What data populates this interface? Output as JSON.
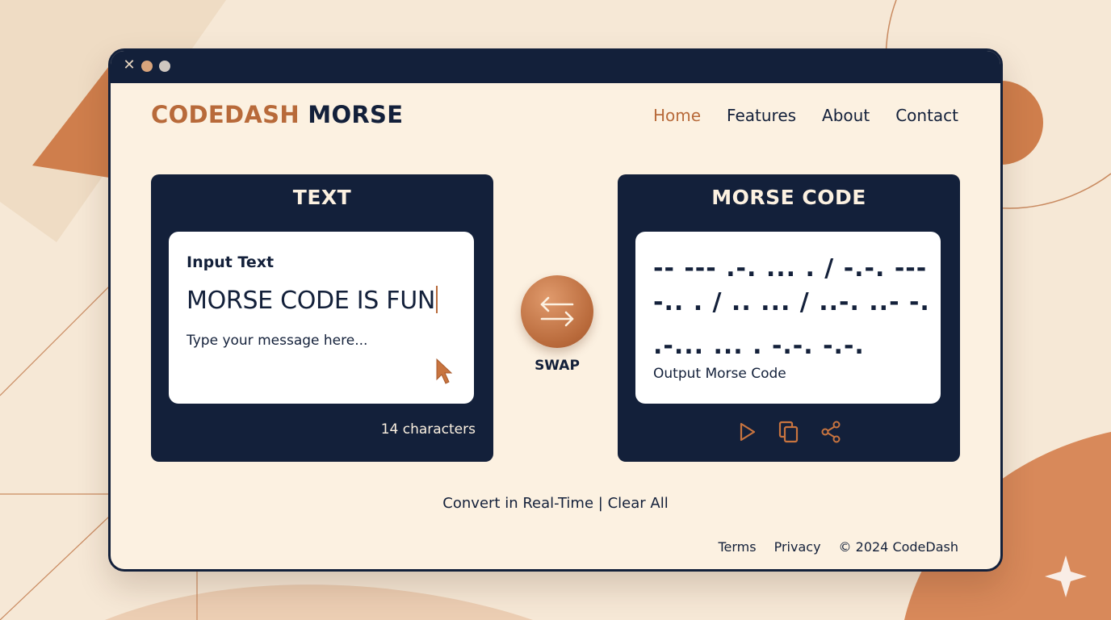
{
  "brand": {
    "part1": "CODEDASH",
    "part2": "MORSE"
  },
  "nav": [
    {
      "label": "Home",
      "active": true
    },
    {
      "label": "Features",
      "active": false
    },
    {
      "label": "About",
      "active": false
    },
    {
      "label": "Contact",
      "active": false
    }
  ],
  "input_panel": {
    "title": "TEXT",
    "label": "Input Text",
    "value": "MORSE CODE IS FUN",
    "placeholder": "Type your message here...",
    "char_count": "14 characters"
  },
  "swap": {
    "label": "SWAP"
  },
  "output_panel": {
    "title": "MORSE CODE",
    "lines": [
      "-- --- .-. ... . / -.-. ---",
      "-.. . / .. ... / ..-. ..- -.",
      ".-... ... . -.-. -.-."
    ],
    "label": "Output Morse Code",
    "actions": [
      "play-icon",
      "copy-icon",
      "share-icon"
    ]
  },
  "footer": {
    "realtime": "Convert in Real-Time",
    "separator": "|",
    "clear": "Clear All",
    "terms": "Terms",
    "privacy": "Privacy",
    "copyright": "© 2024 CodeDash"
  },
  "colors": {
    "navy": "#13203a",
    "accent": "#b86a3a",
    "cream": "#fcf1e1",
    "background": "#f6e8d6"
  }
}
